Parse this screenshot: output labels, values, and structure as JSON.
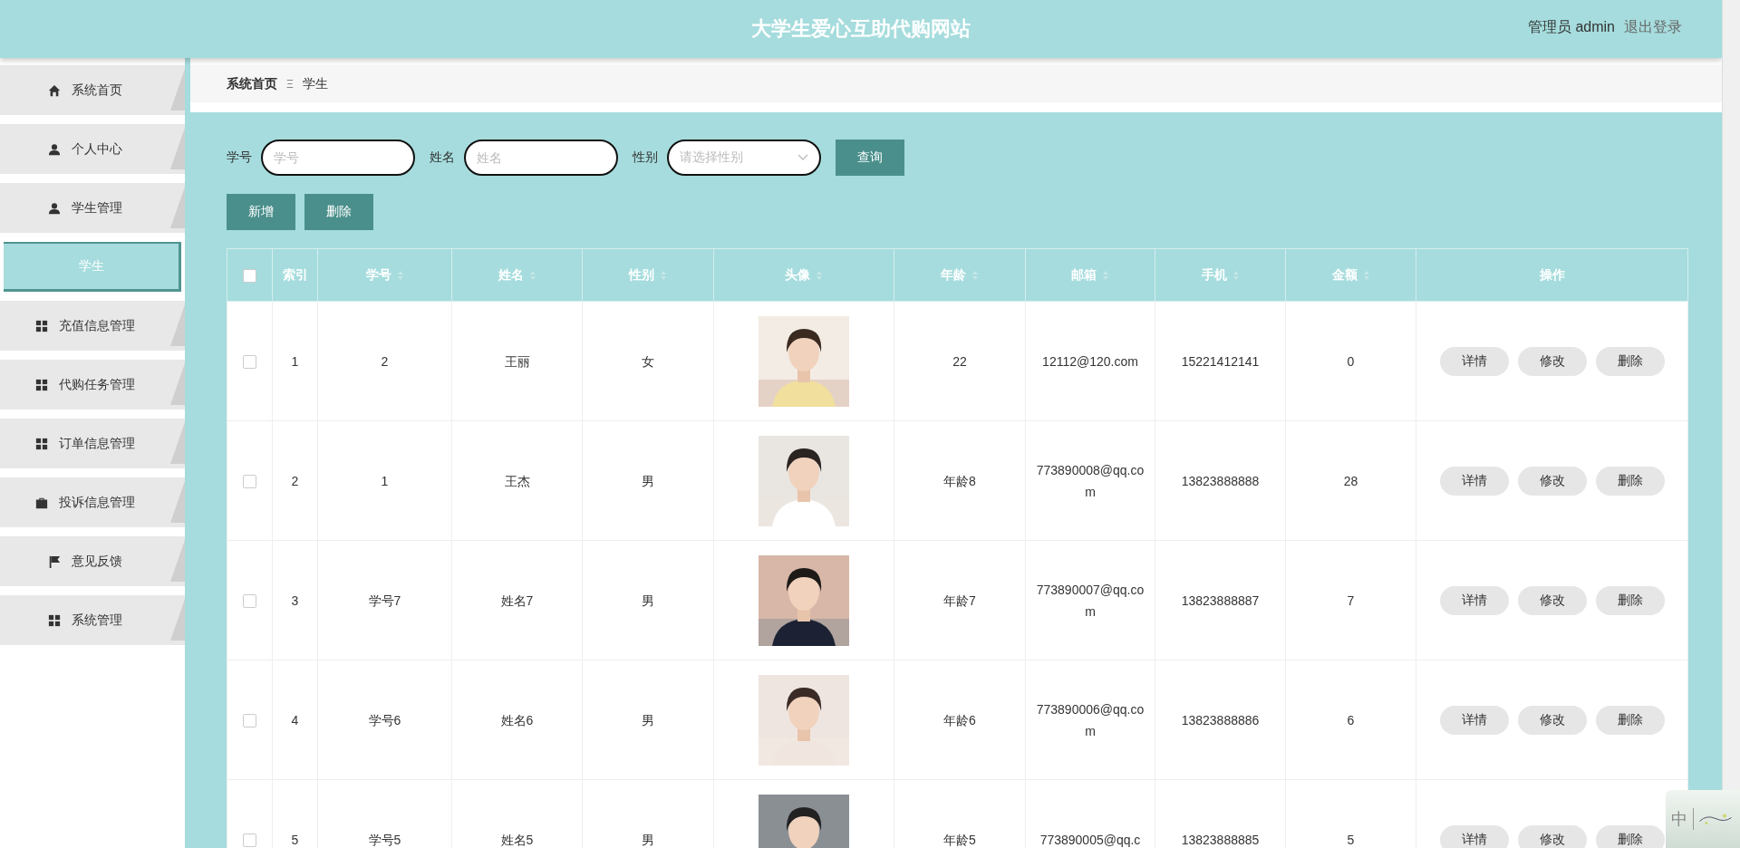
{
  "header": {
    "title": "大学生爱心互助代购网站",
    "user": "管理员 admin",
    "logout": "退出登录"
  },
  "sidebar": {
    "items": [
      {
        "label": "系统首页",
        "selected": false
      },
      {
        "label": "个人中心",
        "selected": false
      },
      {
        "label": "学生管理",
        "selected": false,
        "children": [
          {
            "label": "学生",
            "selected": true
          }
        ]
      },
      {
        "label": "充值信息管理",
        "selected": false
      },
      {
        "label": "代购任务管理",
        "selected": false
      },
      {
        "label": "订单信息管理",
        "selected": false
      },
      {
        "label": "投诉信息管理",
        "selected": false
      },
      {
        "label": "意见反馈",
        "selected": false
      },
      {
        "label": "系统管理",
        "selected": false
      }
    ]
  },
  "breadcrumb": {
    "items": [
      "系统首页",
      "学生"
    ],
    "separator": "Ξ"
  },
  "search": {
    "fields": [
      {
        "kind": "text",
        "label": "学号",
        "placeholder": "学号"
      },
      {
        "kind": "text",
        "label": "姓名",
        "placeholder": "姓名"
      },
      {
        "kind": "select",
        "label": "性别",
        "placeholder": "请选择性别"
      }
    ],
    "button": "查询"
  },
  "actions": [
    "新增",
    "删除"
  ],
  "table": {
    "select_all": {
      "checked": false
    },
    "columns": [
      {
        "label": "索引",
        "sortable": false
      },
      {
        "label": "学号",
        "sortable": true
      },
      {
        "label": "姓名",
        "sortable": true
      },
      {
        "label": "性别",
        "sortable": true
      },
      {
        "label": "头像",
        "sortable": true
      },
      {
        "label": "年龄",
        "sortable": true
      },
      {
        "label": "邮箱",
        "sortable": true
      },
      {
        "label": "手机",
        "sortable": true
      },
      {
        "label": "金额",
        "sortable": true
      },
      {
        "label": "操作",
        "sortable": false
      }
    ],
    "rows": [
      {
        "checked": false,
        "cells": [
          "1",
          "2",
          "王丽",
          "女",
          {
            "kind": "picture"
          },
          "22",
          "12112@120.com",
          "15221412141",
          "0"
        ],
        "buttons": [
          "详情",
          "修改",
          "删除"
        ]
      },
      {
        "checked": false,
        "cells": [
          "2",
          "1",
          "王杰",
          "男",
          {
            "kind": "picture"
          },
          "年龄8",
          "773890008@qq.com",
          "13823888888",
          "28"
        ],
        "buttons": [
          "详情",
          "修改",
          "删除"
        ]
      },
      {
        "checked": false,
        "cells": [
          "3",
          "学号7",
          "姓名7",
          "男",
          {
            "kind": "picture"
          },
          "年龄7",
          "773890007@qq.com",
          "13823888887",
          "7"
        ],
        "buttons": [
          "详情",
          "修改",
          "删除"
        ]
      },
      {
        "checked": false,
        "cells": [
          "4",
          "学号6",
          "姓名6",
          "男",
          {
            "kind": "picture"
          },
          "年龄6",
          "773890006@qq.com",
          "13823888886",
          "6"
        ],
        "buttons": [
          "详情",
          "修改",
          "删除"
        ]
      },
      {
        "checked": false,
        "cells": [
          "5",
          "学号5",
          "姓名5",
          "男",
          {
            "kind": "picture"
          },
          "年龄5",
          "773890005@qq.c",
          "13823888885",
          "5"
        ],
        "buttons": [
          "详情",
          "修改",
          "删除"
        ]
      }
    ]
  },
  "ime": {
    "label": "中"
  }
}
